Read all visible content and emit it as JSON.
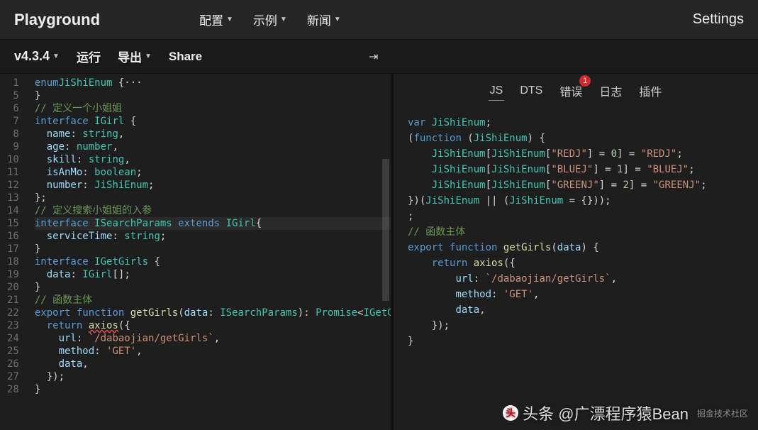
{
  "header": {
    "brand": "Playground",
    "nav": [
      "配置",
      "示例",
      "新闻"
    ],
    "settings": "Settings"
  },
  "subbar": {
    "version": "v4.3.4",
    "run": "运行",
    "export": "导出",
    "share": "Share"
  },
  "editor": {
    "startLine": 1,
    "lines": [
      {
        "n": 1,
        "fold": true,
        "tokens": [
          [
            "s-kw",
            "enum"
          ],
          [
            "",
            ""
          ],
          [
            "s-type",
            "JiShiEnum"
          ],
          [
            "",
            " {"
          ],
          [
            "s-punc",
            "···"
          ]
        ]
      },
      {
        "n": 5,
        "tokens": [
          [
            "",
            "}"
          ]
        ]
      },
      {
        "n": 6,
        "tokens": [
          [
            "s-com",
            "// 定义一个小姐姐"
          ]
        ]
      },
      {
        "n": 7,
        "tokens": [
          [
            "s-kw",
            "interface"
          ],
          [
            "",
            " "
          ],
          [
            "s-type",
            "IGirl"
          ],
          [
            "",
            " {"
          ]
        ]
      },
      {
        "n": 8,
        "tokens": [
          [
            "",
            "  "
          ],
          [
            "s-prop",
            "name"
          ],
          [
            "",
            ": "
          ],
          [
            "s-type",
            "string"
          ],
          [
            "",
            ","
          ]
        ]
      },
      {
        "n": 9,
        "tokens": [
          [
            "",
            "  "
          ],
          [
            "s-prop",
            "age"
          ],
          [
            "",
            ": "
          ],
          [
            "s-type",
            "number"
          ],
          [
            "",
            ","
          ]
        ]
      },
      {
        "n": 10,
        "tokens": [
          [
            "",
            "  "
          ],
          [
            "s-prop",
            "skill"
          ],
          [
            "",
            ": "
          ],
          [
            "s-type",
            "string"
          ],
          [
            "",
            ","
          ]
        ]
      },
      {
        "n": 11,
        "tokens": [
          [
            "",
            "  "
          ],
          [
            "s-prop",
            "isAnMo"
          ],
          [
            "",
            ": "
          ],
          [
            "s-type",
            "boolean"
          ],
          [
            "",
            ";"
          ]
        ]
      },
      {
        "n": 12,
        "tokens": [
          [
            "",
            "  "
          ],
          [
            "s-prop",
            "number"
          ],
          [
            "",
            ": "
          ],
          [
            "s-type",
            "JiShiEnum"
          ],
          [
            "",
            ";"
          ]
        ]
      },
      {
        "n": 13,
        "tokens": [
          [
            "",
            "};"
          ]
        ]
      },
      {
        "n": 14,
        "tokens": [
          [
            "s-com",
            "// 定义搜索小姐姐的入参"
          ]
        ]
      },
      {
        "n": 15,
        "hl": true,
        "tokens": [
          [
            "s-kw",
            "interface"
          ],
          [
            "",
            " "
          ],
          [
            "s-type",
            "ISearchParams"
          ],
          [
            "",
            " "
          ],
          [
            "s-kw",
            "extends"
          ],
          [
            "",
            " "
          ],
          [
            "s-type",
            "IGirl"
          ],
          [
            "",
            "{"
          ]
        ]
      },
      {
        "n": 16,
        "tokens": [
          [
            "",
            "  "
          ],
          [
            "s-prop",
            "serviceTime"
          ],
          [
            "",
            ": "
          ],
          [
            "s-type",
            "string"
          ],
          [
            "",
            ";"
          ]
        ]
      },
      {
        "n": 17,
        "tokens": [
          [
            "",
            "}"
          ]
        ]
      },
      {
        "n": 18,
        "tokens": [
          [
            "s-kw",
            "interface"
          ],
          [
            "",
            " "
          ],
          [
            "s-type",
            "IGetGirls"
          ],
          [
            "",
            " {"
          ]
        ]
      },
      {
        "n": 19,
        "tokens": [
          [
            "",
            "  "
          ],
          [
            "s-prop",
            "data"
          ],
          [
            "",
            ": "
          ],
          [
            "s-type",
            "IGirl"
          ],
          [
            "",
            "[]"
          ],
          [
            "",
            ";"
          ]
        ]
      },
      {
        "n": 20,
        "tokens": [
          [
            "",
            "}"
          ]
        ]
      },
      {
        "n": 21,
        "tokens": [
          [
            "s-com",
            "// 函数主体"
          ]
        ]
      },
      {
        "n": 22,
        "tokens": [
          [
            "s-kw",
            "export"
          ],
          [
            "",
            " "
          ],
          [
            "s-kw",
            "function"
          ],
          [
            "",
            " "
          ],
          [
            "s-fn",
            "getGirls"
          ],
          [
            "",
            "("
          ],
          [
            "s-prop",
            "data"
          ],
          [
            "",
            ": "
          ],
          [
            "s-type",
            "ISearchParams"
          ],
          [
            "",
            "): "
          ],
          [
            "s-type",
            "Promise"
          ],
          [
            "",
            "<"
          ],
          [
            "s-type",
            "IGetGirls"
          ],
          [
            "",
            "> {"
          ]
        ]
      },
      {
        "n": 23,
        "tokens": [
          [
            "",
            "  "
          ],
          [
            "s-kw",
            "return"
          ],
          [
            "",
            " "
          ],
          [
            "s-fn wavy",
            "axios"
          ],
          [
            "",
            "({"
          ]
        ]
      },
      {
        "n": 24,
        "tokens": [
          [
            "",
            "    "
          ],
          [
            "s-prop",
            "url"
          ],
          [
            "",
            ": "
          ],
          [
            "s-str",
            "`/dabaojian/getGirls`"
          ],
          [
            "",
            ","
          ]
        ]
      },
      {
        "n": 25,
        "tokens": [
          [
            "",
            "    "
          ],
          [
            "s-prop",
            "method"
          ],
          [
            "",
            ": "
          ],
          [
            "s-str",
            "'GET'"
          ],
          [
            "",
            ","
          ]
        ]
      },
      {
        "n": 26,
        "tokens": [
          [
            "",
            "    "
          ],
          [
            "s-prop",
            "data"
          ],
          [
            "",
            ","
          ]
        ]
      },
      {
        "n": 27,
        "tokens": [
          [
            "",
            "  });"
          ]
        ]
      },
      {
        "n": 28,
        "tokens": [
          [
            "",
            "}"
          ]
        ]
      }
    ]
  },
  "rightTabs": {
    "items": [
      "JS",
      "DTS",
      "错误",
      "日志",
      "插件"
    ],
    "active": 0,
    "errorBadge": "1"
  },
  "output": {
    "lines": [
      [
        [
          "o-kw",
          "var"
        ],
        [
          "",
          " "
        ],
        [
          "o-type",
          "JiShiEnum"
        ],
        [
          "",
          ";"
        ]
      ],
      [
        [
          "",
          "("
        ],
        [
          "o-kw",
          "function"
        ],
        [
          "",
          " ("
        ],
        [
          "o-type",
          "JiShiEnum"
        ],
        [
          "",
          ") {"
        ]
      ],
      [
        [
          "",
          "    "
        ],
        [
          "o-type",
          "JiShiEnum"
        ],
        [
          "",
          "["
        ],
        [
          "o-type",
          "JiShiEnum"
        ],
        [
          "",
          "["
        ],
        [
          "o-str",
          "\"REDJ\""
        ],
        [
          "",
          "] = "
        ],
        [
          "o-num",
          "0"
        ],
        [
          "",
          "] = "
        ],
        [
          "o-str",
          "\"REDJ\""
        ],
        [
          "",
          ";"
        ]
      ],
      [
        [
          "",
          "    "
        ],
        [
          "o-type",
          "JiShiEnum"
        ],
        [
          "",
          "["
        ],
        [
          "o-type",
          "JiShiEnum"
        ],
        [
          "",
          "["
        ],
        [
          "o-str",
          "\"BLUEJ\""
        ],
        [
          "",
          "] = "
        ],
        [
          "o-num",
          "1"
        ],
        [
          "",
          "] = "
        ],
        [
          "o-str",
          "\"BLUEJ\""
        ],
        [
          "",
          ";"
        ]
      ],
      [
        [
          "",
          "    "
        ],
        [
          "o-type",
          "JiShiEnum"
        ],
        [
          "",
          "["
        ],
        [
          "o-type",
          "JiShiEnum"
        ],
        [
          "",
          "["
        ],
        [
          "o-str",
          "\"GREENJ\""
        ],
        [
          "",
          "] = "
        ],
        [
          "o-num",
          "2"
        ],
        [
          "",
          "] = "
        ],
        [
          "o-str",
          "\"GREENJ\""
        ],
        [
          "",
          ";"
        ]
      ],
      [
        [
          "",
          "})("
        ],
        [
          "o-type",
          "JiShiEnum"
        ],
        [
          "",
          " || ("
        ],
        [
          "o-type",
          "JiShiEnum"
        ],
        [
          "",
          " = {}));"
        ]
      ],
      [
        [
          "",
          ";"
        ]
      ],
      [
        [
          "o-com",
          "// 函数主体"
        ]
      ],
      [
        [
          "o-kw",
          "export"
        ],
        [
          "",
          " "
        ],
        [
          "o-kw",
          "function"
        ],
        [
          "",
          " "
        ],
        [
          "o-fn",
          "getGirls"
        ],
        [
          "",
          "("
        ],
        [
          "o-prop",
          "data"
        ],
        [
          "",
          ") {"
        ]
      ],
      [
        [
          "",
          "    "
        ],
        [
          "o-kw",
          "return"
        ],
        [
          "",
          " "
        ],
        [
          "o-fn",
          "axios"
        ],
        [
          "",
          "({"
        ]
      ],
      [
        [
          "",
          "        "
        ],
        [
          "o-prop",
          "url"
        ],
        [
          "",
          ": "
        ],
        [
          "o-str",
          "`/dabaojian/getGirls`"
        ],
        [
          "",
          ","
        ]
      ],
      [
        [
          "",
          "        "
        ],
        [
          "o-prop",
          "method"
        ],
        [
          "",
          ": "
        ],
        [
          "o-str",
          "'GET'"
        ],
        [
          "",
          ","
        ]
      ],
      [
        [
          "",
          "        "
        ],
        [
          "o-prop",
          "data"
        ],
        [
          "",
          ","
        ]
      ],
      [
        [
          "",
          "    });"
        ]
      ],
      [
        [
          "",
          "}"
        ]
      ]
    ]
  },
  "watermark": {
    "main": "头条 @广漂程序猿Bean",
    "small": "掘金技术社区"
  }
}
